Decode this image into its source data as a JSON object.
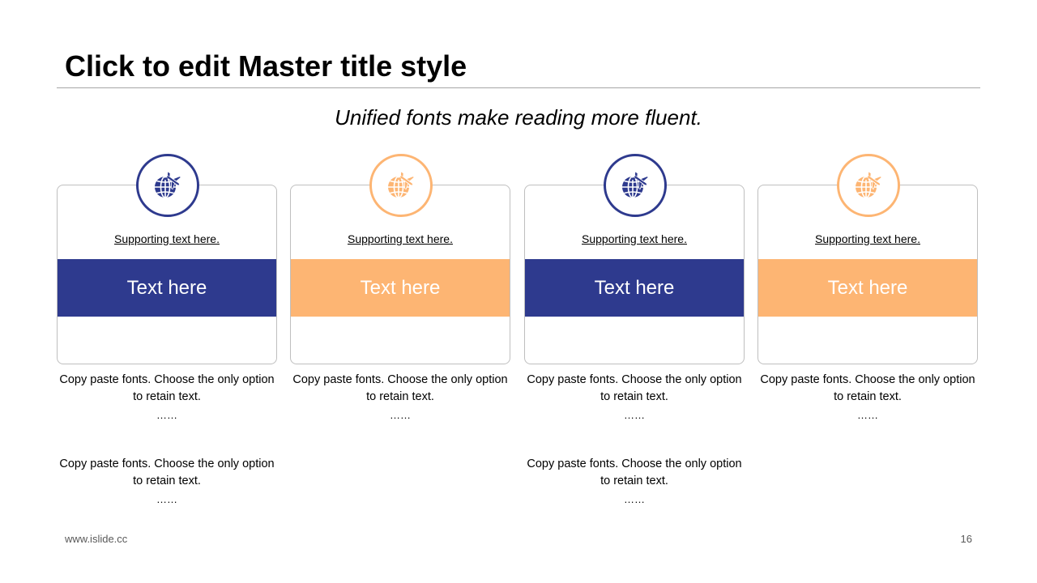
{
  "title": "Click to edit Master title style",
  "subtitle": "Unified fonts make reading more fluent.",
  "colors": {
    "navy": "#2e3a8e",
    "orange": "#fdb573",
    "border": "#bfbfbf",
    "rule": "#a6a6a6"
  },
  "cards": [
    {
      "icon": "globe-plane-icon",
      "color": "#2e3a8e",
      "supporting": "Supporting text here.",
      "band": "Text here",
      "body1": "Copy paste fonts. Choose the only option to retain text.",
      "dots1": "……",
      "body2": "Copy paste fonts. Choose the only option to retain text.",
      "dots2": "……"
    },
    {
      "icon": "globe-plane-icon",
      "color": "#fdb573",
      "supporting": "Supporting text here.",
      "band": "Text here",
      "body1": "Copy paste fonts. Choose the only option to retain text.",
      "dots1": "……",
      "body2": "",
      "dots2": ""
    },
    {
      "icon": "globe-plane-icon",
      "color": "#2e3a8e",
      "supporting": "Supporting text here.",
      "band": "Text here",
      "body1": "Copy paste fonts. Choose the only option to retain text.",
      "dots1": "……",
      "body2": "Copy paste fonts. Choose the only option to retain text.",
      "dots2": "……"
    },
    {
      "icon": "globe-plane-icon",
      "color": "#fdb573",
      "supporting": "Supporting text here.",
      "band": "Text here",
      "body1": "Copy paste fonts. Choose the only option to retain text.",
      "dots1": "……",
      "body2": "",
      "dots2": ""
    }
  ],
  "footer": {
    "url": "www.islide.cc",
    "page": "16"
  }
}
